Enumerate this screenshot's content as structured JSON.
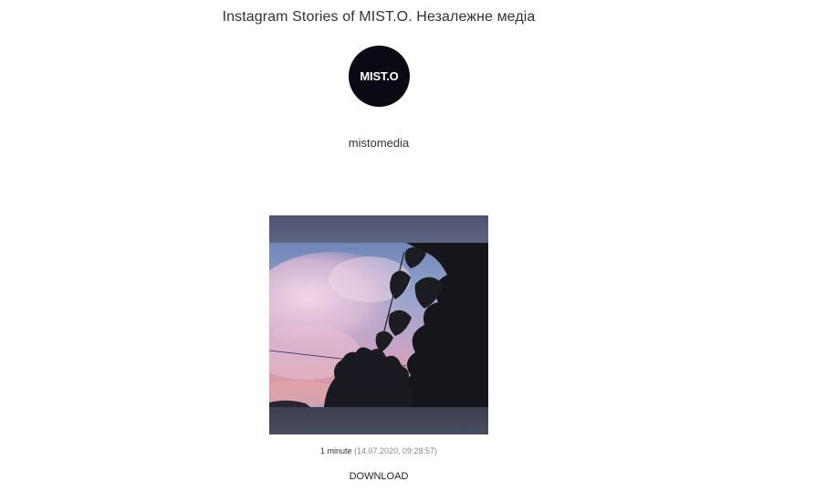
{
  "page": {
    "title": "Instagram Stories of MIST.O. Незалежне медіа"
  },
  "profile": {
    "avatar_text": "MIST.O",
    "username": "mistomedia"
  },
  "story": {
    "duration": "1 minute",
    "timestamp": "(14.07.2020, 09:28:57)",
    "download_label": "DOWNLOAD"
  }
}
